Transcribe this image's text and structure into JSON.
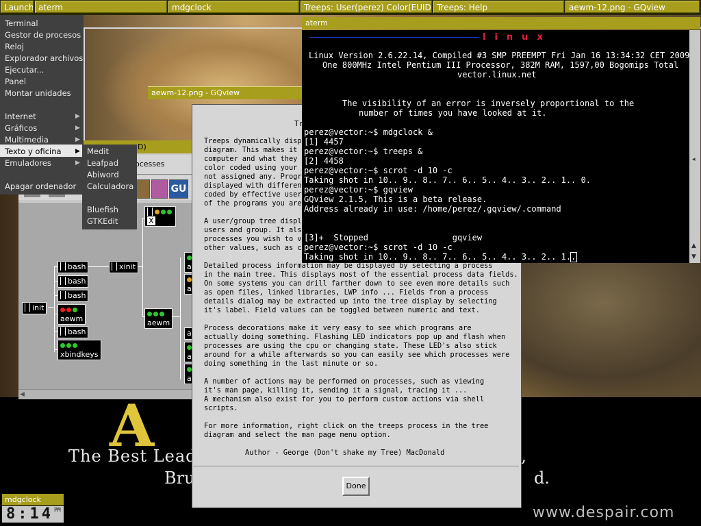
{
  "taskbar": {
    "items": [
      "Launch",
      "aterm",
      "mdgclock",
      "Treeps: User(perez) Color(EUID)",
      "Treeps: Help",
      "aewm-12.png - GQview"
    ]
  },
  "launch_menu": {
    "items": [
      "Terminal",
      "Gestor de procesos",
      "Reloj",
      "Explorador archivos",
      "Ejecutar...",
      "Panel",
      "Montar unidades",
      "Internet",
      "Gráficos",
      "Multimedia",
      "Texto y oficina",
      "Emuladores",
      "Apagar ordenador"
    ],
    "submenu_items": [
      "Medit",
      "Leafpad",
      "Abiword",
      "Calculadora",
      "Bluefish",
      "GTKEdit"
    ]
  },
  "treeps": {
    "title_fragment": "D)",
    "menu_fragment": "ocesses",
    "toolbar_icon_label": "GU",
    "processes": {
      "init": "init",
      "bash": "bash",
      "xinit": "xinit",
      "aewm": "aewm",
      "xbindkeys": "xbindkeys",
      "x": "X",
      "a": "a"
    }
  },
  "help": {
    "title_fragment": "Tr",
    "paragraphs": [
      "Treeps dynamically displ\ndiagram. This makes it v\ncomputer and what they a\ncolor coded using your i\nnot assigned any. Progra\ndisplayed with different\ncoded by effective user\nof the programs you are",
      "A user/group tree displa\nusers and group. It also\nprocesses you wish to vi\nother values, such as cp",
      "Detailed process information may be displayed by selecting a process\nin the main tree. This displays most of the essential process data fields.\nOn some systems you can drill farther down to see even more details such\nas open files, linked libraries, LWP info ... Fields from a process\ndetails dialog may be extracted up into the tree display by selecting\nit's label. Field values can be toggled between numeric and text.",
      "Process decorations make it very easy to see which programs are\nactually doing something. Flashing LED indicators pop up and flash when\nprocesses are using the cpu or changing state. These LED's also stick\naround for a while afterwards so you can easily see which processes were\ndoing something in the last minute or so.",
      "A number of actions may be performed on processes, such as viewing\nit's man page, killing it, sending it a signal, tracing it ...\nA mechanism also exist for you to perform custom actions via shell\nscripts.",
      "For more information, right click on the treeps process in the tree\ndiagram and select the man page menu option."
    ],
    "author": "Author - George (Don't shake my Tree) MacDonald",
    "done_label": "Done"
  },
  "gqview": {
    "title": "aewm-12.png - GQview"
  },
  "aterm": {
    "title": "aterm",
    "banner_letters": "linux",
    "header": [
      "Linux Version 2.6.22.14, Compiled #3 SMP PREEMPT Fri Jan 16 13:34:32 CET 2009",
      "One 800MHz Intel Pentium III Processor, 382M RAM, 1597,00 Bogomips Total",
      "vector.linux.net"
    ],
    "fortune": [
      "The visibility of an error is inversely proportional to the",
      "number of times you have looked at it."
    ],
    "session": [
      "perez@vector:~$ mdgclock &",
      "[1] 4457",
      "perez@vector:~$ treeps &",
      "[2] 4458",
      "perez@vector:~$ scrot -d 10 -c",
      "Taking shot in 10.. 9.. 8.. 7.. 6.. 5.. 4.. 3.. 2.. 1.. 0.",
      "perez@vector:~$ gqview",
      "GQview 2.1.5, This is a beta release.",
      "Address already in use: /home/perez/.gqview/.command",
      "",
      "",
      "[3]+  Stopped                 gqview",
      "perez@vector:~$ scrot -d 10 -c",
      "Taking shot in 10.. 9.. 8.. 7.. 6.. 5.. 4.. 3.. 2.. 1.. "
    ]
  },
  "poster": {
    "word": "A      CE",
    "line1": "The Best Leade                                    t an Option,",
    "line2": "Bru",
    "line3": "d.",
    "url": "www.despair.com"
  },
  "clock": {
    "title": "mdgclock",
    "time": "8:14",
    "ampm": "PM"
  }
}
